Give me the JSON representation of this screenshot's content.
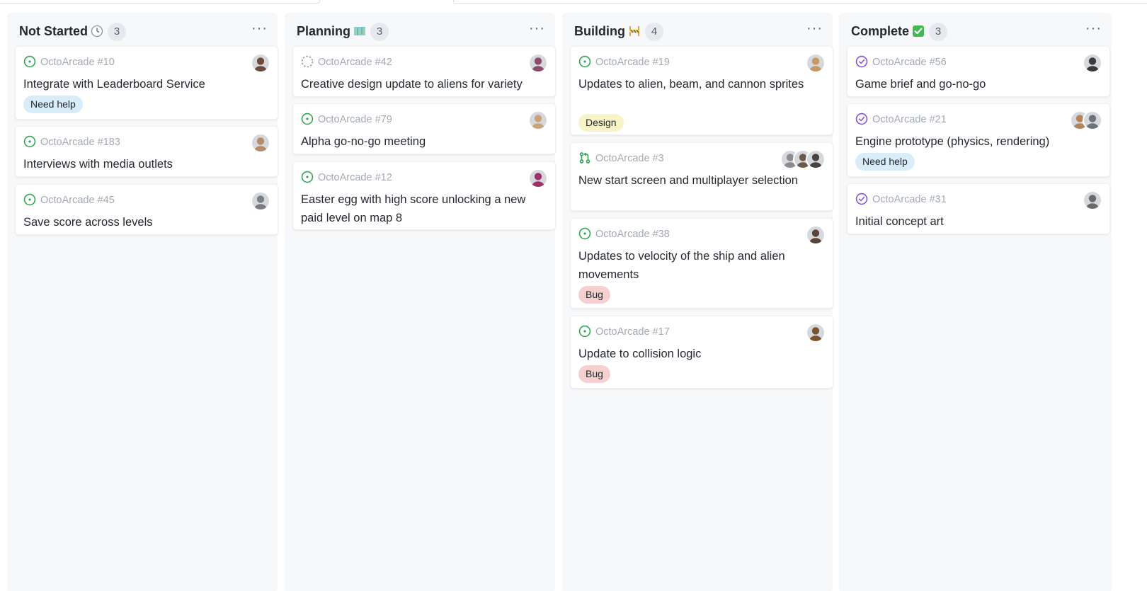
{
  "board": {
    "columns": [
      {
        "title": "Not Started",
        "emoji": "clock-icon",
        "count": "3",
        "menu": "···",
        "cards": [
          {
            "ref": "OctoArcade #10",
            "status": "open-issue",
            "title": "Integrate with Leaderboard Service",
            "label": "Need help",
            "label_kind": "help",
            "avatars": [
              "#6b4a3a"
            ]
          },
          {
            "ref": "OctoArcade #183",
            "status": "open-issue",
            "title": "Interviews with media outlets",
            "label": "",
            "label_kind": "",
            "avatars": [
              "#b88a6c"
            ]
          },
          {
            "ref": "OctoArcade #45",
            "status": "open-issue",
            "title": "Save score across levels",
            "label": "",
            "label_kind": "",
            "avatars": [
              "#7a7f86"
            ]
          }
        ]
      },
      {
        "title": "Planning",
        "emoji": "map-icon",
        "count": "3",
        "menu": "···",
        "cards": [
          {
            "ref": "OctoArcade #42",
            "status": "draft-issue",
            "title": "Creative design update to aliens for variety",
            "label": "",
            "label_kind": "",
            "avatars": [
              "#8c4a6a"
            ]
          },
          {
            "ref": "OctoArcade #79",
            "status": "open-issue",
            "title": "Alpha go-no-go meeting",
            "label": "",
            "label_kind": "",
            "avatars": [
              "#c9a27a"
            ]
          },
          {
            "ref": "OctoArcade #12",
            "status": "open-issue",
            "title": "Easter egg with high score unlocking a new paid level on map 8",
            "label": "",
            "label_kind": "",
            "avatars": [
              "#a0306a"
            ]
          }
        ]
      },
      {
        "title": "Building",
        "emoji": "construction-icon",
        "count": "4",
        "menu": "···",
        "cards": [
          {
            "ref": "OctoArcade #19",
            "status": "open-issue",
            "title": "Updates to alien, beam, and cannon sprites",
            "label": "Design",
            "label_kind": "design",
            "avatars": [
              "#c89866"
            ]
          },
          {
            "ref": "OctoArcade #3",
            "status": "open-pr",
            "title": "New start screen and multiplayer selection",
            "label": "",
            "label_kind": "",
            "avatars": [
              "#8d8d8d",
              "#6f5a4a",
              "#4a4040"
            ]
          },
          {
            "ref": "OctoArcade #38",
            "status": "open-issue",
            "title": "Updates to velocity of the ship and alien movements",
            "label": "Bug",
            "label_kind": "bug",
            "avatars": [
              "#5a4638"
            ]
          },
          {
            "ref": "OctoArcade #17",
            "status": "open-issue",
            "title": "Update to collision logic",
            "label": "Bug",
            "label_kind": "bug",
            "avatars": [
              "#7a5230"
            ]
          }
        ]
      },
      {
        "title": "Complete",
        "emoji": "check-mark-icon",
        "count": "3",
        "menu": "···",
        "cards": [
          {
            "ref": "OctoArcade #56",
            "status": "closed-issue",
            "title": "Game brief and go-no-go",
            "label": "",
            "label_kind": "",
            "avatars": [
              "#3a3a3a"
            ]
          },
          {
            "ref": "OctoArcade #21",
            "status": "closed-issue",
            "title": "Engine prototype (physics, rendering)",
            "label": "Need help",
            "label_kind": "help",
            "avatars": [
              "#b5835a",
              "#6e7379"
            ]
          },
          {
            "ref": "OctoArcade #31",
            "status": "closed-issue",
            "title": "Initial concept art",
            "label": "",
            "label_kind": "",
            "avatars": [
              "#6a6a6a"
            ]
          }
        ]
      }
    ]
  },
  "colors": {
    "open": "#2da44e",
    "closed": "#8250df",
    "draft": "#8c959f",
    "help_bg": "#d8ecf9",
    "design_bg": "#f8f4c8",
    "bug_bg": "#f6cfcf"
  }
}
